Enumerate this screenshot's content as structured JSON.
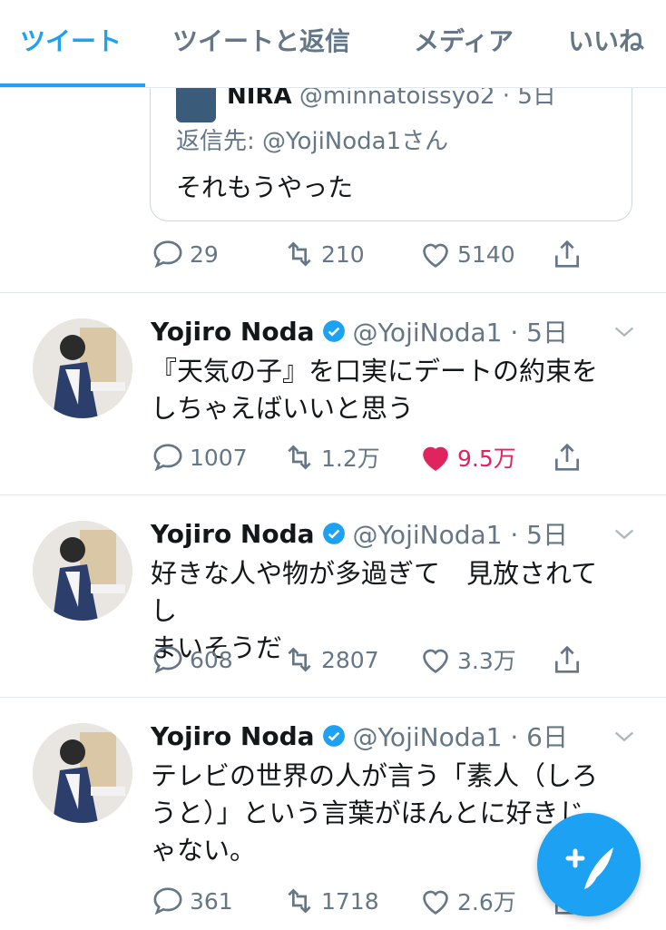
{
  "tabs": [
    {
      "label": "ツイート",
      "active": true
    },
    {
      "label": "ツイートと返信",
      "active": false
    },
    {
      "label": "メディア",
      "active": false
    },
    {
      "label": "いいね",
      "active": false
    }
  ],
  "quoted": {
    "name": "NIRA",
    "handle_meta": "@minnatoissyo2 · 5日",
    "reply_to": "返信先: @YojiNoda1さん",
    "text": "それもうやった"
  },
  "top_actions": {
    "replies": "29",
    "retweets": "210",
    "likes": "5140"
  },
  "tweets": [
    {
      "name": "Yojiro Noda",
      "meta": "@YojiNoda1 · 5日",
      "text": "『天気の子』を口実にデートの約束を\nしちゃえばいいと思う",
      "replies": "1007",
      "retweets": "1.2万",
      "likes": "9.5万",
      "liked": true
    },
    {
      "name": "Yojiro Noda",
      "meta": "@YojiNoda1 · 5日",
      "text": "好きな人や物が多過ぎて　見放されてし\nまいそうだ",
      "replies": "608",
      "retweets": "2807",
      "likes": "3.3万",
      "liked": false
    },
    {
      "name": "Yojiro Noda",
      "meta": "@YojiNoda1 · 6日",
      "text": "テレビの世界の人が言う「素人（しろ\nうと）」という言葉がほんとに好きじ\nゃない。",
      "replies": "361",
      "retweets": "1718",
      "likes": "2.6万",
      "liked": false
    }
  ],
  "colors": {
    "accent": "#1da1f2",
    "like": "#e0245e",
    "muted": "#657786"
  },
  "icons": [
    "reply-icon",
    "retweet-icon",
    "like-icon",
    "share-icon",
    "verified-icon",
    "chevron-down-icon",
    "compose-tweet-icon"
  ]
}
